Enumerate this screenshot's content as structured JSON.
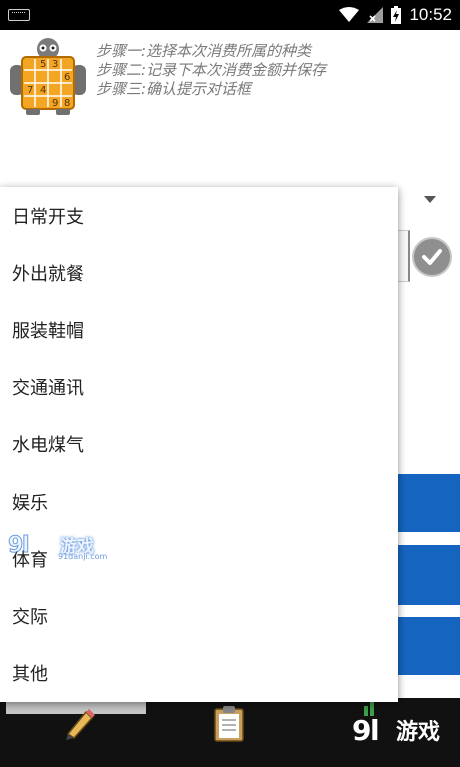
{
  "status_bar": {
    "time": "10:52",
    "icons": [
      "keyboard-icon",
      "wifi-icon",
      "signal-icon",
      "battery-charging-icon"
    ]
  },
  "header": {
    "logo_icon": "sudoku-robot-icon",
    "logo_digits": [
      "5",
      "3",
      "6",
      "7",
      "4",
      "9",
      "8"
    ],
    "steps": [
      "步骤一:选择本次消费所属的种类",
      "步骤二:记录下本次消费金额并保存",
      "步骤三:确认提示对话框"
    ]
  },
  "dropdown": {
    "options": [
      "日常开支",
      "外出就餐",
      "服装鞋帽",
      "交通通讯",
      "水电煤气",
      "娱乐",
      "体育",
      "交际",
      "其他"
    ]
  },
  "bottom_bar": {
    "tabs": [
      "pencil-icon",
      "clipboard-icon",
      "chart-icon"
    ]
  },
  "watermark": {
    "mid_text": "游戏",
    "mid_sub": "91danji.com",
    "corner_text": "游戏"
  },
  "colors": {
    "accent_blue": "#1565c0",
    "step_text": "#7a7a7a",
    "status_bar": "#000000"
  }
}
